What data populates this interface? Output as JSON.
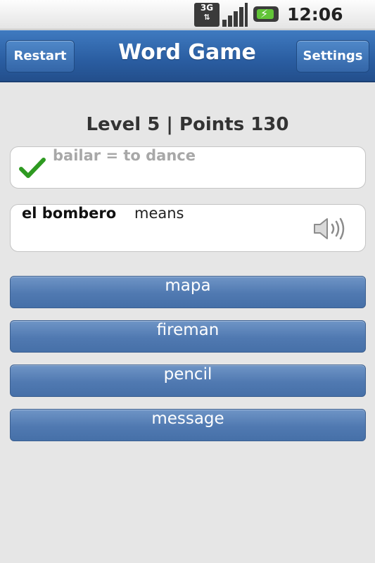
{
  "status_bar": {
    "network_badge": "3G",
    "network_arrows": "⇅",
    "signal_icon": "signal-icon",
    "battery_icon": "battery-charging-icon",
    "time": "12:06 PM"
  },
  "titlebar": {
    "restart_label": "Restart",
    "title": "Word Game",
    "settings_label": "Settings",
    "color": "#2a5da1"
  },
  "score": {
    "text": "Level 5 | Points 130",
    "level": 5,
    "points": 130
  },
  "last_answer": {
    "icon": "check-icon",
    "text": "bailar = to dance",
    "icon_color": "#2e9a21"
  },
  "question": {
    "word": "el bombero",
    "means": "means",
    "icon": "speaker-icon"
  },
  "answers": [
    {
      "label": "mapa"
    },
    {
      "label": "fireman"
    },
    {
      "label": "pencil"
    },
    {
      "label": "message"
    }
  ]
}
